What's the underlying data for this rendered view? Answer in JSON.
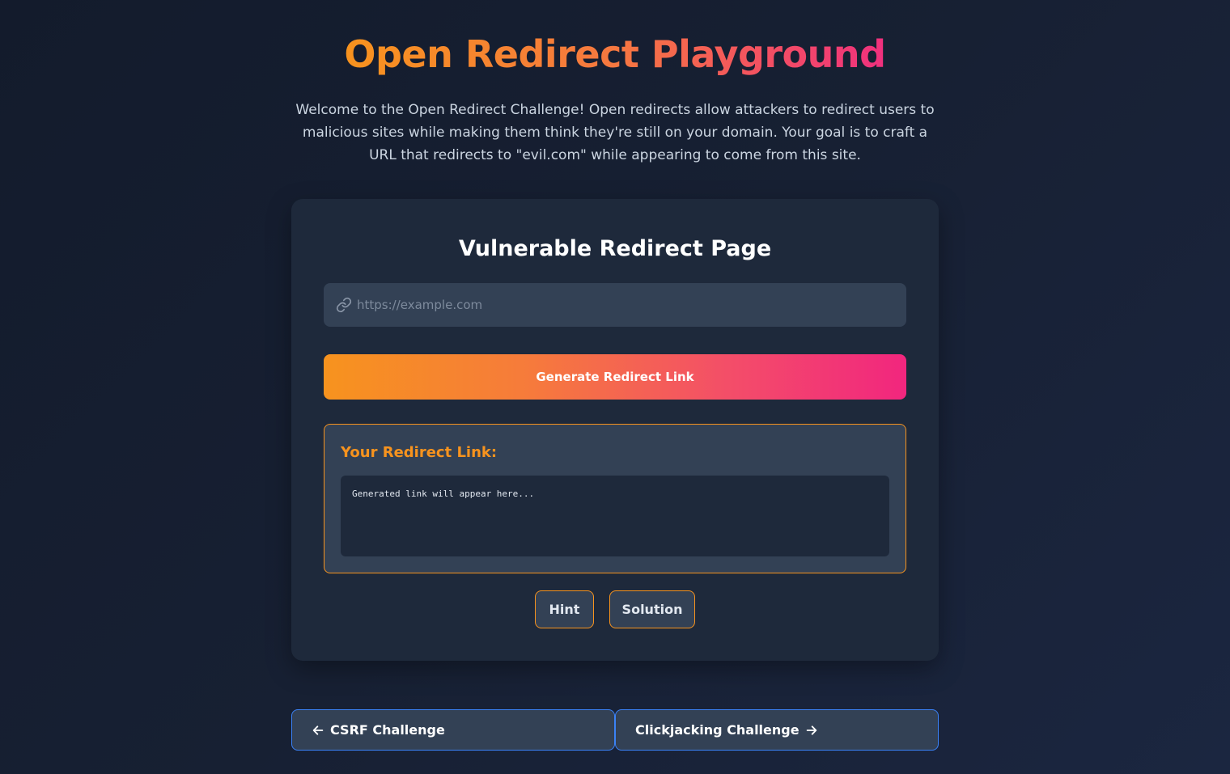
{
  "header": {
    "title": "Open Redirect Playground",
    "intro": "Welcome to the Open Redirect Challenge! Open redirects allow attackers to redirect users to malicious sites while making them think they're still on your domain. Your goal is to craft a URL that redirects to \"evil.com\" while appearing to come from this site."
  },
  "card": {
    "title": "Vulnerable Redirect Page",
    "url_input": {
      "placeholder": "https://example.com",
      "value": "",
      "icon": "link-icon"
    },
    "generate_label": "Generate Redirect Link",
    "result": {
      "label": "Your Redirect Link:",
      "output": "Generated link will appear here..."
    },
    "hint_label": "Hint",
    "solution_label": "Solution"
  },
  "nav": {
    "prev_label": "CSRF Challenge",
    "prev_icon": "arrow-left-icon",
    "next_label": "Clickjacking Challenge",
    "next_icon": "arrow-right-icon"
  },
  "colors": {
    "background": "#172033",
    "card": "#1e293b",
    "field": "#334155",
    "accent_orange": "#f7931e",
    "accent_pink": "#f2267e",
    "nav_border": "#3b82f6"
  }
}
